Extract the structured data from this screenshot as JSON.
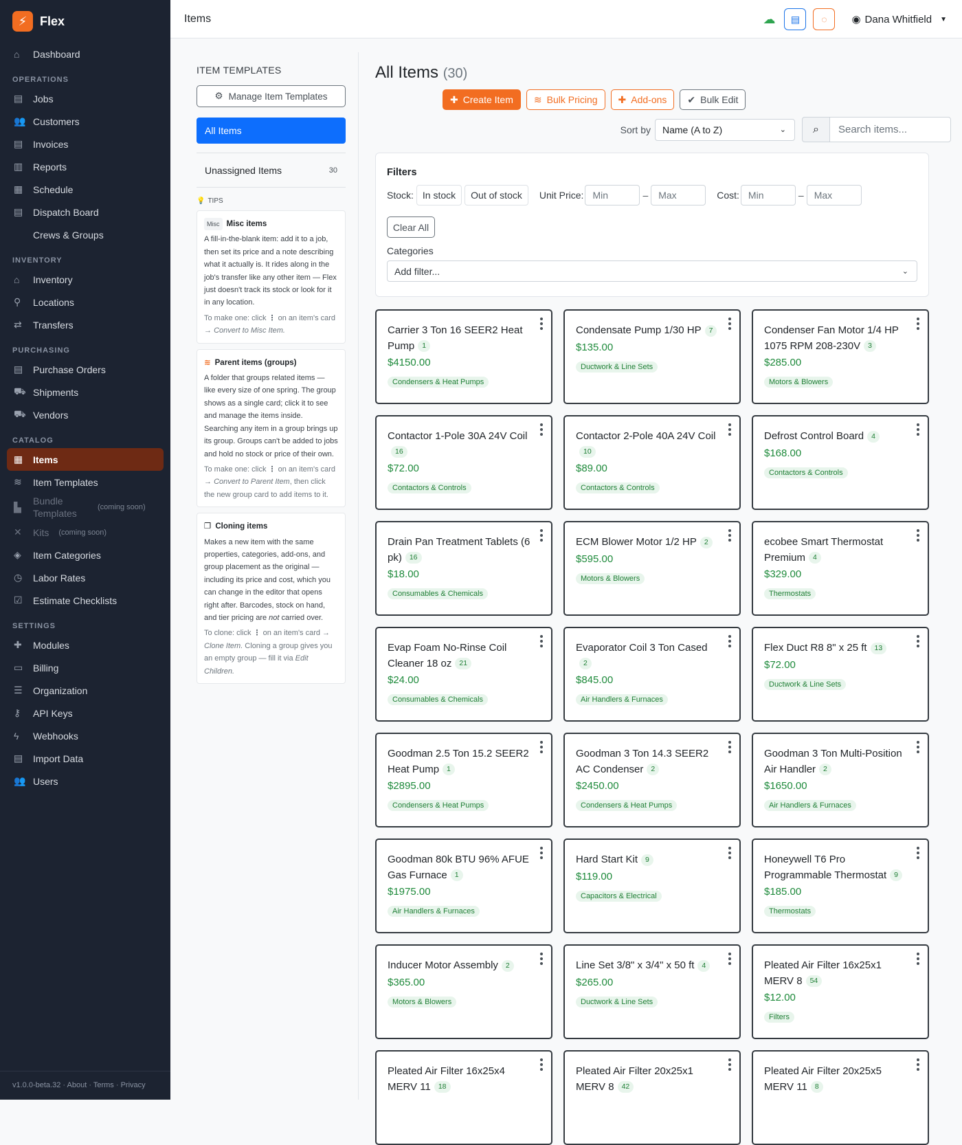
{
  "app": {
    "name": "Flex",
    "logo_glyph": "⚡"
  },
  "topbar": {
    "title": "Items",
    "user_name": "Dana Whitfield"
  },
  "sidebar": {
    "dashboard": "Dashboard",
    "sections": [
      {
        "label": "OPERATIONS",
        "items": [
          "Jobs",
          "Customers",
          "Invoices",
          "Reports",
          "Schedule",
          "Dispatch Board",
          "Crews & Groups"
        ]
      },
      {
        "label": "INVENTORY",
        "items": [
          "Inventory",
          "Locations",
          "Transfers"
        ]
      },
      {
        "label": "PURCHASING",
        "items": [
          "Purchase Orders",
          "Shipments",
          "Vendors"
        ]
      },
      {
        "label": "CATALOG",
        "items": [
          "Items",
          "Item Templates",
          "Bundle Templates",
          "Kits",
          "Item Categories",
          "Labor Rates",
          "Estimate Checklists"
        ]
      },
      {
        "label": "SETTINGS",
        "items": [
          "Modules",
          "Billing",
          "Organization",
          "API Keys",
          "Webhooks",
          "Import Data",
          "Users"
        ]
      }
    ],
    "coming_soon": "(coming soon)",
    "footer": {
      "version": "v1.0.0-beta.32",
      "about": "About",
      "terms": "Terms",
      "privacy": "Privacy"
    }
  },
  "left_panel": {
    "title": "ITEM TEMPLATES",
    "manage_button": "Manage Item Templates",
    "all_items": "All Items",
    "unassigned": "Unassigned Items",
    "unassigned_count": "30",
    "tips_label": "TIPS",
    "tips": [
      {
        "pill": "Misc",
        "title": "Misc items",
        "body": "A fill-in-the-blank item: add it to a job, then set its price and a note describing what it actually is. It rides along in the job's transfer like any other item — Flex just doesn't track its stock or look for it in any location.",
        "note_a": "To make one: click ",
        "note_b": " on an item's card → ",
        "note_em": "Convert to Misc Item."
      },
      {
        "title": "Parent items (groups)",
        "body": "A folder that groups related items — like every size of one spring. The group shows as a single card; click it to see and manage the items inside. Searching any item in a group brings up its group. Groups can't be added to jobs and hold no stock or price of their own.",
        "note_a": "To make one: click ",
        "note_b": " on an item's card → ",
        "note_em": "Convert to Parent Item",
        "note_c": ", then click the new group card to add items to it."
      },
      {
        "title": "Cloning items",
        "body_a": "Makes a new item with the same properties, categories, add-ons, and group placement as the original — including its price and cost, which you can change in the editor that opens right after. Barcodes, stock on hand, and tier pricing are ",
        "body_em": "not",
        "body_b": " carried over.",
        "note_a": "To clone: click ",
        "note_b": " on an item's card → ",
        "note_em": "Clone Item.",
        "note_c": " Cloning a group gives you an empty group — fill it via ",
        "note_em2": "Edit Children."
      }
    ]
  },
  "main": {
    "title": "All Items",
    "count": "(30)",
    "buttons": {
      "create": "Create Item",
      "bulk_pricing": "Bulk Pricing",
      "addons": "Add-ons",
      "bulk_edit": "Bulk Edit"
    },
    "sort_label": "Sort by",
    "sort_value": "Name (A to Z)",
    "search_placeholder": "Search items...",
    "filters": {
      "title": "Filters",
      "stock_label": "Stock:",
      "in_stock": "In stock",
      "out_of_stock": "Out of stock",
      "unit_price_label": "Unit Price:",
      "cost_label": "Cost:",
      "min": "Min",
      "max": "Max",
      "dash": "–",
      "clear_all": "Clear All",
      "categories_label": "Categories",
      "add_filter": "Add filter..."
    },
    "items": [
      {
        "name": "Carrier 3 Ton 16 SEER2 Heat Pump",
        "qty": "1",
        "price": "$4150.00",
        "category": "Condensers & Heat Pumps"
      },
      {
        "name": "Condensate Pump 1/30 HP",
        "qty": "7",
        "price": "$135.00",
        "category": "Ductwork & Line Sets"
      },
      {
        "name": "Condenser Fan Motor 1/4 HP 1075 RPM 208-230V",
        "qty": "3",
        "price": "$285.00",
        "category": "Motors & Blowers"
      },
      {
        "name": "Contactor 1-Pole 30A 24V Coil",
        "qty": "16",
        "price": "$72.00",
        "category": "Contactors & Controls"
      },
      {
        "name": "Contactor 2-Pole 40A 24V Coil",
        "qty": "10",
        "price": "$89.00",
        "category": "Contactors & Controls"
      },
      {
        "name": "Defrost Control Board",
        "qty": "4",
        "price": "$168.00",
        "category": "Contactors & Controls"
      },
      {
        "name": "Drain Pan Treatment Tablets (6 pk)",
        "qty": "16",
        "price": "$18.00",
        "category": "Consumables & Chemicals"
      },
      {
        "name": "ECM Blower Motor 1/2 HP",
        "qty": "2",
        "price": "$595.00",
        "category": "Motors & Blowers"
      },
      {
        "name": "ecobee Smart Thermostat Premium",
        "qty": "4",
        "price": "$329.00",
        "category": "Thermostats"
      },
      {
        "name": "Evap Foam No-Rinse Coil Cleaner 18 oz",
        "qty": "21",
        "price": "$24.00",
        "category": "Consumables & Chemicals"
      },
      {
        "name": "Evaporator Coil 3 Ton Cased",
        "qty": "2",
        "price": "$845.00",
        "category": "Air Handlers & Furnaces"
      },
      {
        "name": "Flex Duct R8 8\" x 25 ft",
        "qty": "13",
        "price": "$72.00",
        "category": "Ductwork & Line Sets"
      },
      {
        "name": "Goodman 2.5 Ton 15.2 SEER2 Heat Pump",
        "qty": "1",
        "price": "$2895.00",
        "category": "Condensers & Heat Pumps"
      },
      {
        "name": "Goodman 3 Ton 14.3 SEER2 AC Condenser",
        "qty": "2",
        "price": "$2450.00",
        "category": "Condensers & Heat Pumps"
      },
      {
        "name": "Goodman 3 Ton Multi-Position Air Handler",
        "qty": "2",
        "price": "$1650.00",
        "category": "Air Handlers & Furnaces"
      },
      {
        "name": "Goodman 80k BTU 96% AFUE Gas Furnace",
        "qty": "1",
        "price": "$1975.00",
        "category": "Air Handlers & Furnaces"
      },
      {
        "name": "Hard Start Kit",
        "qty": "9",
        "price": "$119.00",
        "category": "Capacitors & Electrical"
      },
      {
        "name": "Honeywell T6 Pro Programmable Thermostat",
        "qty": "9",
        "price": "$185.00",
        "category": "Thermostats"
      },
      {
        "name": "Inducer Motor Assembly",
        "qty": "2",
        "price": "$365.00",
        "category": "Motors & Blowers"
      },
      {
        "name": "Line Set 3/8\" x 3/4\" x 50 ft",
        "qty": "4",
        "price": "$265.00",
        "category": "Ductwork & Line Sets"
      },
      {
        "name": "Pleated Air Filter 16x25x1 MERV 8",
        "qty": "54",
        "price": "$12.00",
        "category": "Filters"
      },
      {
        "name": "Pleated Air Filter 16x25x4 MERV 11",
        "qty": "18",
        "price": "",
        "category": ""
      },
      {
        "name": "Pleated Air Filter 20x25x1 MERV 8",
        "qty": "42",
        "price": "",
        "category": ""
      },
      {
        "name": "Pleated Air Filter 20x25x5 MERV 11",
        "qty": "8",
        "price": "",
        "category": ""
      }
    ]
  },
  "colors": {
    "sidebar_bg": "#1c2331",
    "accent_orange": "#f26d21",
    "primary_blue": "#0d6efd",
    "active_nav": "#6e2a14",
    "price_green": "#1e8a3b"
  }
}
